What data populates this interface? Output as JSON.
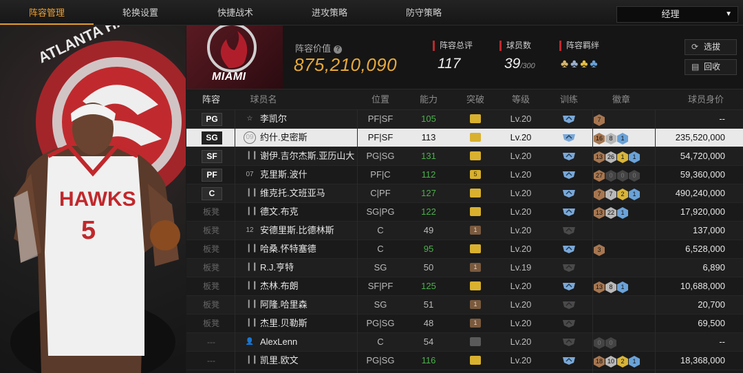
{
  "tabs": [
    {
      "label": "阵容管理",
      "active": true
    },
    {
      "label": "轮换设置"
    },
    {
      "label": "快捷战术"
    },
    {
      "label": "进攻策略"
    },
    {
      "label": "防守策略"
    }
  ],
  "manager_select": {
    "label": "经理"
  },
  "player_panel": {
    "team_text": "ATLANTA HAWKS",
    "jersey_team": "HAWKS",
    "jersey_number": "5"
  },
  "team": {
    "name": "MIAMI",
    "lineup_value_label": "阵容价值",
    "lineup_value": "875,210,090",
    "total_rating_label": "阵容总评",
    "total_rating": "117",
    "player_count_label": "球员数",
    "player_count": "39",
    "player_count_max": "/300",
    "synergy_label": "阵容羁绊",
    "select_label": "选拔",
    "recycle_label": "回收"
  },
  "columns": [
    "阵容",
    "球员名",
    "位置",
    "能力",
    "突破",
    "等级",
    "训练",
    "徽章",
    "球员身价"
  ],
  "rows": [
    {
      "slot": "PG",
      "num": "☆",
      "name": "李凯尔",
      "pos": "PF|SF",
      "ovr": "105",
      "ovr_green": true,
      "crown": "gold",
      "crown_text": "",
      "lv": "Lv.20",
      "train": "on",
      "badges": [
        {
          "t": "7",
          "c": "bronze"
        }
      ],
      "value": "--"
    },
    {
      "slot": "SG",
      "num": "09",
      "name": "约什.史密斯",
      "pos": "PF|SF",
      "ovr": "113",
      "ovr_green": false,
      "crown": "gold",
      "crown_text": "",
      "lv": "Lv.20",
      "train": "on",
      "badges": [
        {
          "t": "16",
          "c": "bronze"
        },
        {
          "t": "8",
          "c": "silver"
        },
        {
          "t": "1",
          "c": "blue"
        }
      ],
      "value": "235,520,000",
      "selected": true
    },
    {
      "slot": "SF",
      "num": "bars",
      "name": "谢伊.吉尔杰斯.亚历山大",
      "pos": "PG|SG",
      "ovr": "131",
      "ovr_green": true,
      "crown": "gold",
      "crown_text": "",
      "lv": "Lv.20",
      "train": "on",
      "badges": [
        {
          "t": "13",
          "c": "bronze"
        },
        {
          "t": "26",
          "c": "silver"
        },
        {
          "t": "1",
          "c": "gold"
        },
        {
          "t": "1",
          "c": "blue"
        }
      ],
      "value": "54,720,000"
    },
    {
      "slot": "PF",
      "num": "07",
      "name": "克里斯.波什",
      "pos": "PF|C",
      "ovr": "112",
      "ovr_green": true,
      "crown": "gold",
      "crown_text": "5",
      "lv": "Lv.20",
      "train": "on",
      "badges": [
        {
          "t": "27",
          "c": "bronze"
        },
        {
          "t": "0",
          "c": "dim"
        },
        {
          "t": "0",
          "c": "dim"
        },
        {
          "t": "0",
          "c": "dim"
        }
      ],
      "value": "59,360,000"
    },
    {
      "slot": "C",
      "num": "bars",
      "name": "维克托.文班亚马",
      "pos": "C|PF",
      "ovr": "127",
      "ovr_green": true,
      "crown": "gold",
      "crown_text": "",
      "lv": "Lv.20",
      "train": "on",
      "badges": [
        {
          "t": "7",
          "c": "bronze"
        },
        {
          "t": "7",
          "c": "silver"
        },
        {
          "t": "2",
          "c": "gold"
        },
        {
          "t": "1",
          "c": "blue"
        }
      ],
      "value": "490,240,000"
    },
    {
      "slot": "板凳",
      "num": "bars",
      "name": "德文.布克",
      "pos": "SG|PG",
      "ovr": "122",
      "ovr_green": true,
      "crown": "gold",
      "crown_text": "",
      "lv": "Lv.20",
      "train": "on",
      "badges": [
        {
          "t": "13",
          "c": "bronze"
        },
        {
          "t": "22",
          "c": "silver"
        },
        {
          "t": "1",
          "c": "blue"
        }
      ],
      "value": "17,920,000"
    },
    {
      "slot": "板凳",
      "num": "12",
      "name": "安德里斯.比德林斯",
      "pos": "C",
      "ovr": "49",
      "ovr_green": false,
      "crown": "bronze",
      "crown_text": "1",
      "lv": "Lv.20",
      "train": "off",
      "badges": [],
      "value": "137,000"
    },
    {
      "slot": "板凳",
      "num": "bars",
      "name": "哈桑.怀特塞德",
      "pos": "C",
      "ovr": "95",
      "ovr_green": true,
      "crown": "gold",
      "crown_text": "",
      "lv": "Lv.20",
      "train": "on",
      "badges": [
        {
          "t": "3",
          "c": "bronze"
        }
      ],
      "value": "6,528,000"
    },
    {
      "slot": "板凳",
      "num": "bars",
      "name": "R.J.亨特",
      "pos": "SG",
      "ovr": "50",
      "ovr_green": false,
      "crown": "bronze",
      "crown_text": "1",
      "lv": "Lv.19",
      "train": "off",
      "badges": [],
      "value": "6,890"
    },
    {
      "slot": "板凳",
      "num": "bars",
      "name": "杰林.布朗",
      "pos": "SF|PF",
      "ovr": "125",
      "ovr_green": true,
      "crown": "gold",
      "crown_text": "",
      "lv": "Lv.20",
      "train": "on",
      "badges": [
        {
          "t": "13",
          "c": "bronze"
        },
        {
          "t": "8",
          "c": "silver"
        },
        {
          "t": "1",
          "c": "blue"
        }
      ],
      "value": "10,688,000"
    },
    {
      "slot": "板凳",
      "num": "bars",
      "name": "阿隆.哈里森",
      "pos": "SG",
      "ovr": "51",
      "ovr_green": false,
      "crown": "bronze",
      "crown_text": "1",
      "lv": "Lv.20",
      "train": "off",
      "badges": [],
      "value": "20,700"
    },
    {
      "slot": "板凳",
      "num": "bars",
      "name": "杰里.贝勒斯",
      "pos": "PG|SG",
      "ovr": "48",
      "ovr_green": false,
      "crown": "bronze",
      "crown_text": "1",
      "lv": "Lv.20",
      "train": "off",
      "badges": [],
      "value": "69,500"
    },
    {
      "slot": "---",
      "num": "person",
      "name": "AlexLenn",
      "pos": "C",
      "ovr": "54",
      "ovr_green": false,
      "crown": "silver",
      "crown_text": "",
      "lv": "Lv.20",
      "train": "off",
      "badges": [
        {
          "t": "0",
          "c": "dim"
        },
        {
          "t": "0",
          "c": "dim"
        }
      ],
      "value": "--"
    },
    {
      "slot": "---",
      "num": "bars",
      "name": "凯里.欧文",
      "pos": "PG|SG",
      "ovr": "116",
      "ovr_green": true,
      "crown": "gold",
      "crown_text": "",
      "lv": "Lv.20",
      "train": "on",
      "badges": [
        {
          "t": "18",
          "c": "bronze"
        },
        {
          "t": "10",
          "c": "silver"
        },
        {
          "t": "2",
          "c": "gold"
        },
        {
          "t": "1",
          "c": "blue"
        }
      ],
      "value": "18,368,000"
    }
  ]
}
